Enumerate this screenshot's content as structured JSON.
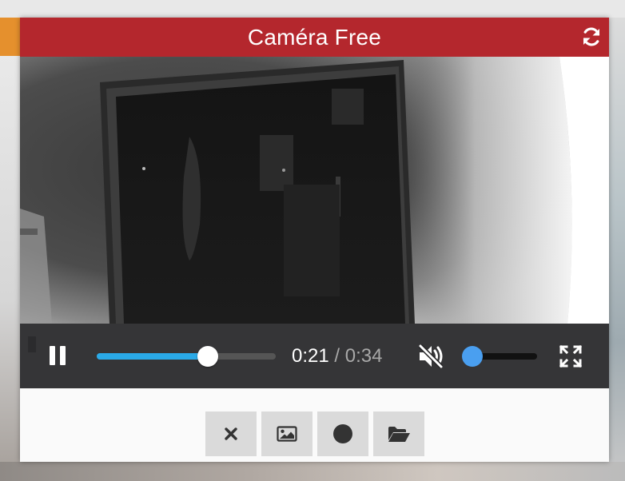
{
  "window": {
    "title": "Caméra Free"
  },
  "header": {
    "refresh_icon": "refresh-icon"
  },
  "player": {
    "state": "playing",
    "current_time": "0:21",
    "separator": "/",
    "duration": "0:34",
    "progress_fraction": 0.62,
    "muted": true,
    "volume_fraction": 0.0,
    "colors": {
      "progress": "#2aaae8",
      "volume": "#4a9ff0",
      "controls_bg": "#262628"
    }
  },
  "footer": {
    "buttons": [
      {
        "icon": "close-icon"
      },
      {
        "icon": "image-icon"
      },
      {
        "icon": "record-icon"
      },
      {
        "icon": "folder-open-icon"
      }
    ]
  },
  "theme": {
    "header_color": "#b4272d",
    "button_bg": "#dadada"
  }
}
